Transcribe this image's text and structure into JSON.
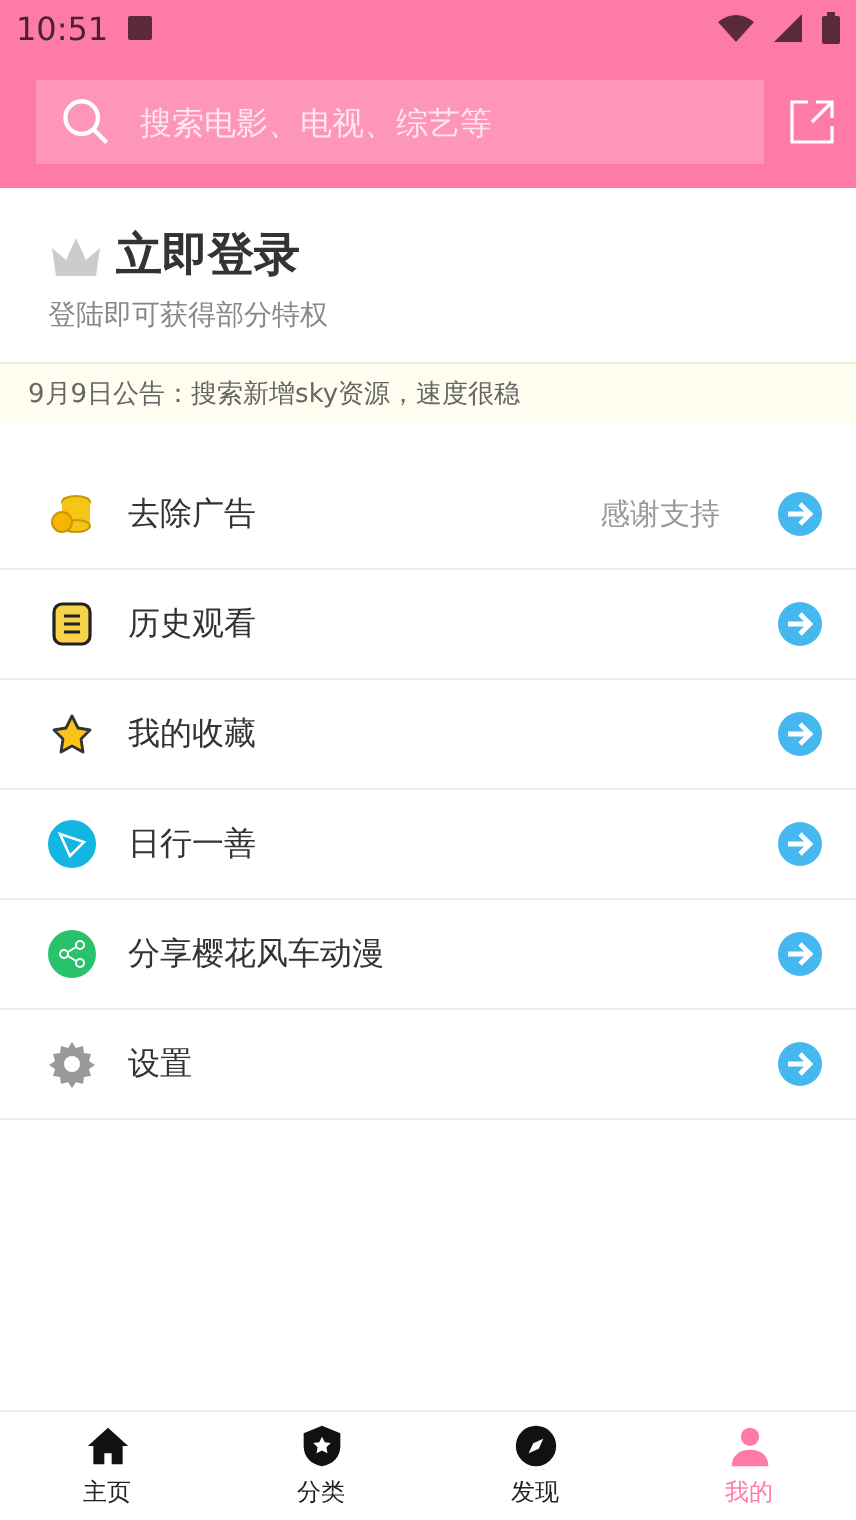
{
  "status_bar": {
    "time": "10:51"
  },
  "search": {
    "placeholder": "搜索电影、电视、综艺等"
  },
  "login": {
    "title": "立即登录",
    "subtitle": "登陆即可获得部分特权"
  },
  "notice": "9月9日公告：搜索新增sky资源，速度很稳",
  "menu": [
    {
      "kind": "coins",
      "label": "去除广告",
      "note": "感谢支持"
    },
    {
      "kind": "history",
      "label": "历史观看"
    },
    {
      "kind": "star",
      "label": "我的收藏"
    },
    {
      "kind": "plane",
      "label": "日行一善"
    },
    {
      "kind": "share",
      "label": "分享樱花风车动漫"
    },
    {
      "kind": "gear",
      "label": "设置"
    }
  ],
  "tabs": [
    {
      "kind": "home",
      "label": "主页",
      "selected": false
    },
    {
      "kind": "category",
      "label": "分类",
      "selected": false
    },
    {
      "kind": "discover",
      "label": "发现",
      "selected": false
    },
    {
      "kind": "me",
      "label": "我的",
      "selected": true
    }
  ]
}
